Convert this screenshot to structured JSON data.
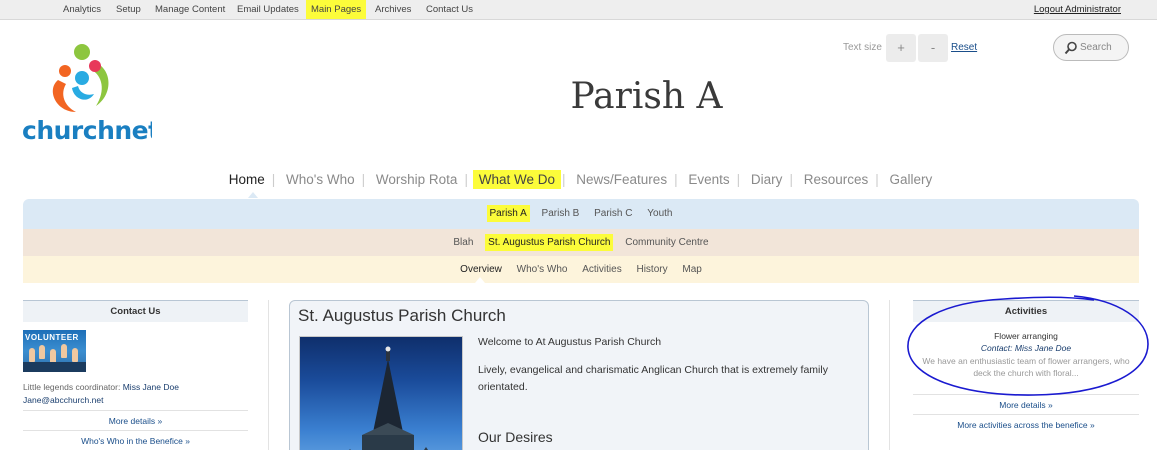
{
  "admin_bar": {
    "items": [
      "Analytics",
      "Setup",
      "Manage Content",
      "Email Updates",
      "Main Pages",
      "Archives",
      "Contact Us"
    ],
    "highlighted": "Main Pages",
    "logout": "Logout Administrator"
  },
  "logo": {
    "text": "churchnet.co"
  },
  "text_size": {
    "label": "Text size",
    "increase": "+",
    "decrease": "-",
    "reset": "Reset"
  },
  "search": {
    "placeholder": "Search"
  },
  "site_title": "Parish A",
  "main_nav": {
    "items": [
      "Home",
      "Who's Who",
      "Worship Rota",
      "What We Do",
      "News/Features",
      "Events",
      "Diary",
      "Resources",
      "Gallery"
    ],
    "active": "Home",
    "highlighted": "What We Do"
  },
  "sub_nav_1": {
    "items": [
      "Parish A",
      "Parish B",
      "Parish C",
      "Youth"
    ],
    "highlighted": "Parish A"
  },
  "sub_nav_2": {
    "items": [
      "Blah",
      "St. Augustus Parish Church",
      "Community Centre"
    ],
    "highlighted": "St. Augustus Parish Church"
  },
  "sub_nav_3": {
    "items": [
      "Overview",
      "Who's Who",
      "Activities",
      "History",
      "Map"
    ],
    "active": "Overview"
  },
  "contact_panel": {
    "heading": "Contact Us",
    "image_text": "VOLUNTEER",
    "role_label": "Little legends coordinator:",
    "name": "Miss Jane Doe",
    "email": "Jane@abcchurch.net",
    "more_details": "More details »",
    "whos_who_link": "Who's Who in the Benefice »"
  },
  "main_card": {
    "title": "St. Augustus Parish Church",
    "welcome": "Welcome to At Augustus Parish Church",
    "description": "Lively, evangelical and charismatic Anglican Church that is extremely family orientated.",
    "subheading": "Our Desires"
  },
  "activities_panel": {
    "heading": "Activities",
    "activity_title": "Flower arranging",
    "contact": "Contact: Miss Jane Doe",
    "description": "We have an enthusiastic team of flower arrangers, who deck the church with floral...",
    "more_details": "More details »",
    "more_activities": "More activities across the benefice »"
  },
  "colors": {
    "highlight": "#fcfc3a",
    "band_blue": "#dbe9f5",
    "band_tan": "#f2e5d9",
    "band_cream": "#fdf4dc",
    "link": "#1a4e8a",
    "annotation": "#1a1ad0"
  }
}
